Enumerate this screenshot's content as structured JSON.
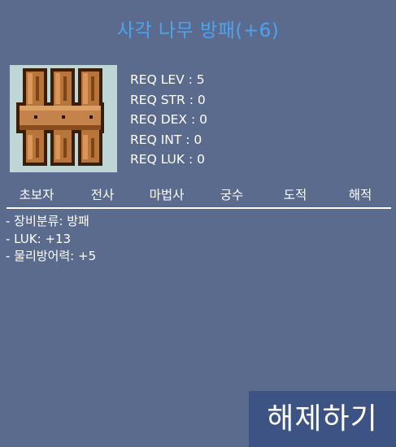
{
  "item": {
    "name": "사각 나무 방패(+6)",
    "icon": "wooden-square-shield-icon"
  },
  "requirements": [
    {
      "label": "REQ LEV : 5"
    },
    {
      "label": "REQ STR : 0"
    },
    {
      "label": "REQ DEX : 0"
    },
    {
      "label": "REQ INT : 0"
    },
    {
      "label": "REQ LUK : 0"
    }
  ],
  "jobs": [
    "초보자",
    "전사",
    "마법사",
    "궁수",
    "도적",
    "해적"
  ],
  "stats": [
    "- 장비분류: 방패",
    "- LUK: +13",
    "- 물리방어력: +5"
  ],
  "actions": {
    "release_label": "해제하기"
  },
  "colors": {
    "background": "#5b6b8e",
    "title": "#4da3ee",
    "button": "#3c5384",
    "text": "#ffffff"
  }
}
